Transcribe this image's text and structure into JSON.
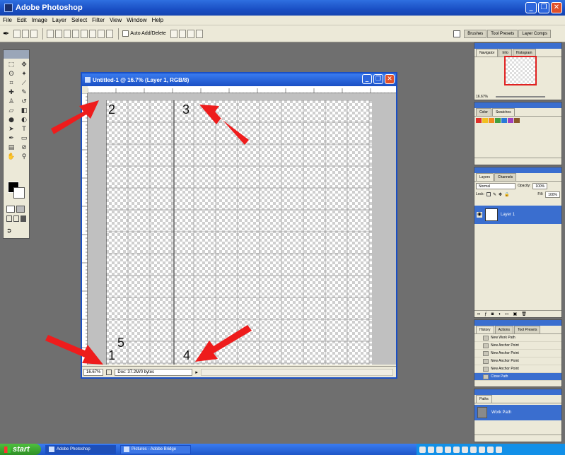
{
  "app": {
    "title": "Adobe Photoshop"
  },
  "menu": [
    "File",
    "Edit",
    "Image",
    "Layer",
    "Select",
    "Filter",
    "View",
    "Window",
    "Help"
  ],
  "options_bar": {
    "auto_add_delete": "Auto Add/Delete"
  },
  "palette_well": {
    "tabs": [
      "Brushes",
      "Tool Presets",
      "Layer Comps"
    ]
  },
  "document": {
    "title": "Untitled-1 @ 16.7% (Layer 1, RGB/8)",
    "zoom": "16.67%",
    "status": "Doc: 37.2M/0 bytes",
    "labels": [
      "2",
      "3",
      "5",
      "1",
      "4"
    ]
  },
  "navigator": {
    "tabs": [
      "Navigator",
      "Info",
      "Histogram"
    ],
    "zoom": "16.67%"
  },
  "color": {
    "tabs": [
      "Color",
      "Swatches"
    ],
    "swatch_colors": [
      "#e0302a",
      "#f0c020",
      "#f08a20",
      "#40a040",
      "#2a7ad8",
      "#a040c0",
      "#8a5a2a"
    ]
  },
  "layers": {
    "tabs": [
      "Layers",
      "Channels"
    ],
    "blend_mode": "Normal",
    "opacity_label": "Opacity:",
    "opacity": "100%",
    "lock_label": "Lock:",
    "fill_label": "Fill:",
    "fill": "100%",
    "items": [
      {
        "name": "Layer 1"
      }
    ]
  },
  "history": {
    "tabs": [
      "History",
      "Actions",
      "Tool Presets"
    ],
    "items": [
      "New Work Path",
      "New Anchor Point",
      "New Anchor Point",
      "New Anchor Point",
      "New Anchor Point",
      "Close Path"
    ]
  },
  "paths": {
    "tabs": [
      "Paths"
    ],
    "items": [
      {
        "name": "Work Path"
      }
    ]
  },
  "taskbar": {
    "start": "start",
    "tasks": [
      "Adobe Photoshop",
      "Pictures - Adobe Bridge"
    ]
  }
}
